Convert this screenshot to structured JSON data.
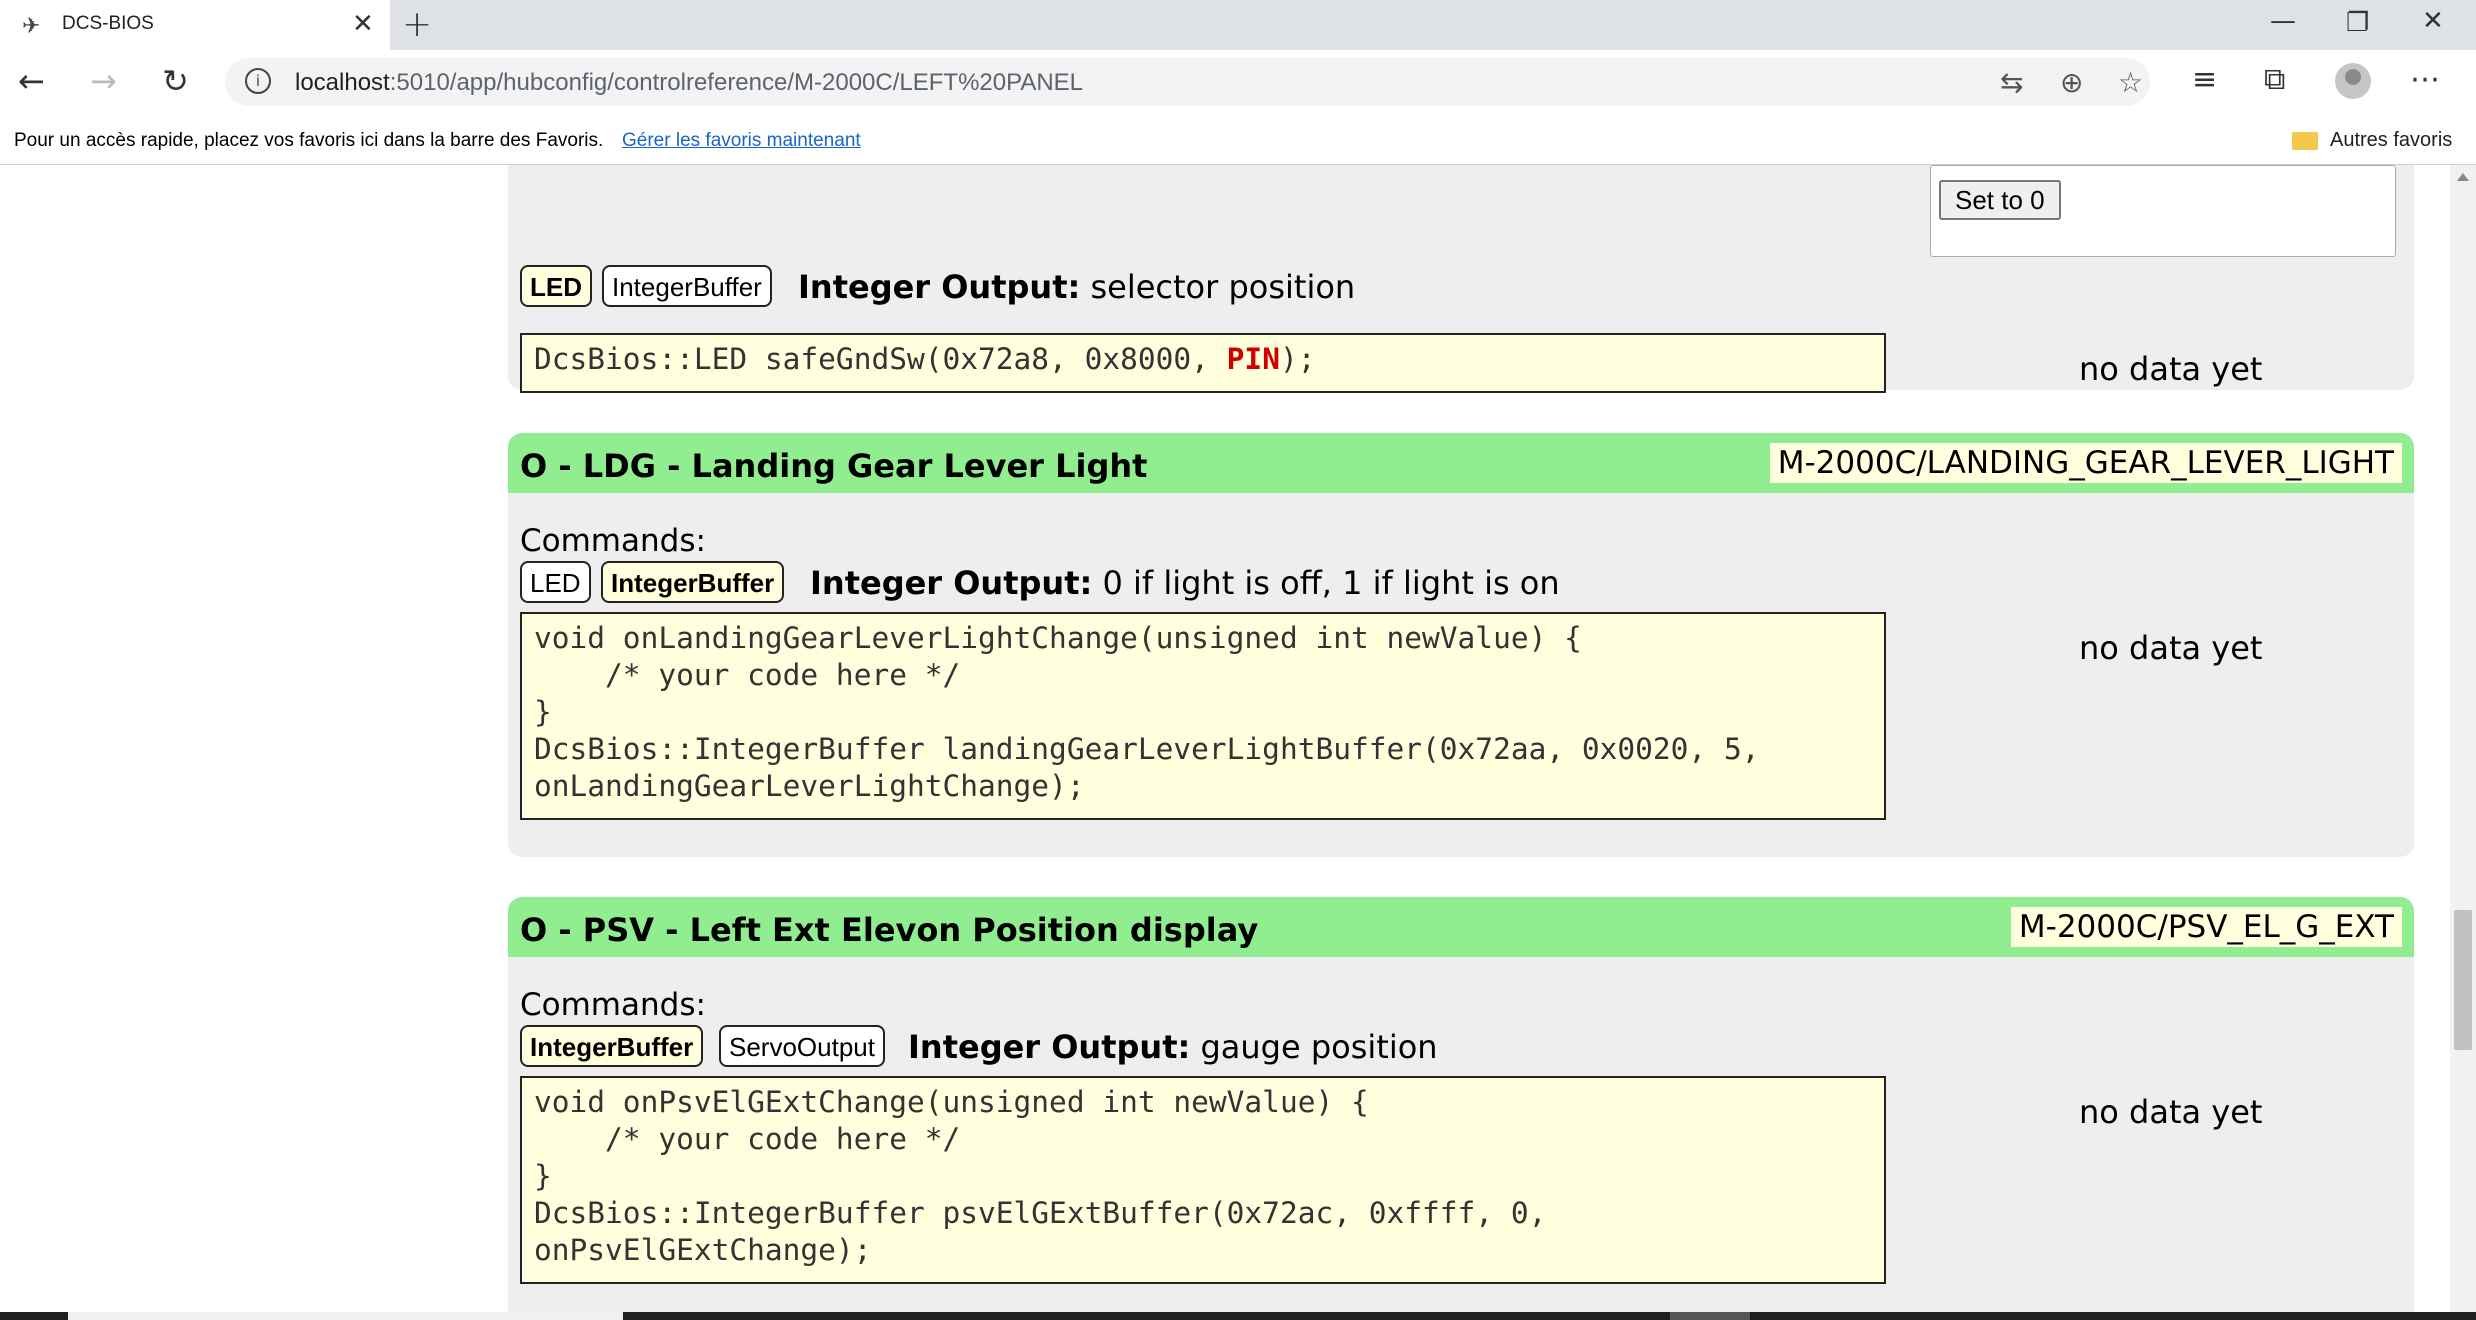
{
  "browser": {
    "tab_title": "DCS-BIOS",
    "tab_close": "✕",
    "new_tab": "+",
    "url_host": "localhost",
    "url_rest": ":5010/app/hubconfig/controlreference/M-2000C/LEFT%20PANEL",
    "favorites_hint": "Pour un accès rapide, placez vos favoris ici dans la barre des Favoris.",
    "favorites_link": "Gérer les favoris maintenant",
    "other_favorites": "Autres favoris"
  },
  "prev_block": {
    "set_button": "Set to 0",
    "tabs": [
      "LED",
      "IntegerBuffer"
    ],
    "output_type": "Integer Output:",
    "output_desc": " selector position",
    "code_prefix": "DcsBios::LED safeGndSw(0x72a8, 0x8000, ",
    "code_pin": "PIN",
    "code_suffix": ");",
    "status": "no data yet"
  },
  "blocks": [
    {
      "title": "O - LDG - Landing Gear Lever Light",
      "identifier": "M-2000C/LANDING_GEAR_LEVER_LIGHT",
      "commands_label": "Commands:",
      "tabs": [
        "LED",
        "IntegerBuffer"
      ],
      "output_type": "Integer Output:",
      "output_desc": " 0 if light is off, 1 if light is on",
      "code": "void onLandingGearLeverLightChange(unsigned int newValue) {\n    /* your code here */\n}\nDcsBios::IntegerBuffer landingGearLeverLightBuffer(0x72aa, 0x0020, 5,\nonLandingGearLeverLightChange);",
      "status": "no data yet"
    },
    {
      "title": "O - PSV - Left Ext Elevon Position display",
      "identifier": "M-2000C/PSV_EL_G_EXT",
      "commands_label": "Commands:",
      "tabs": [
        "IntegerBuffer",
        "ServoOutput"
      ],
      "output_type": "Integer Output:",
      "output_desc": " gauge position",
      "code": "void onPsvElGExtChange(unsigned int newValue) {\n    /* your code here */\n}\nDcsBios::IntegerBuffer psvElGExtBuffer(0x72ac, 0xffff, 0,\nonPsvElGExtChange);",
      "status": "no data yet"
    }
  ]
}
